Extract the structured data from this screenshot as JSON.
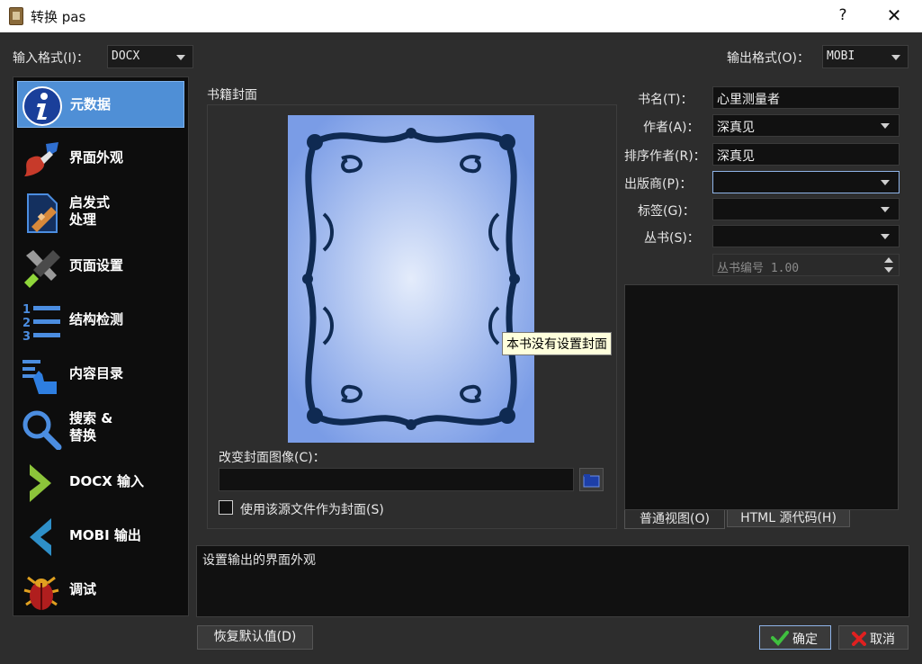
{
  "window": {
    "title": "转换 pas",
    "help": "?",
    "close": "✕"
  },
  "input_format": {
    "label": "输入格式(I)：",
    "value": "DOCX"
  },
  "output_format": {
    "label": "输出格式(O)：",
    "value": "MOBI"
  },
  "sidebar": {
    "items": [
      {
        "label": "元数据",
        "icon": "info-icon",
        "selected": true
      },
      {
        "label": "界面外观",
        "icon": "paintbrush-icon"
      },
      {
        "label1": "启发式",
        "label2": "处理",
        "icon": "document-bandage-icon"
      },
      {
        "label": "页面设置",
        "icon": "tools-icon"
      },
      {
        "label": "结构检测",
        "icon": "numbered-list-icon"
      },
      {
        "label": "内容目录",
        "icon": "toc-hand-icon"
      },
      {
        "label1": "搜索 &",
        "label2": "替换",
        "icon": "magnifier-icon"
      },
      {
        "label": "DOCX 输入",
        "icon": "chevron-right-icon"
      },
      {
        "label": "MOBI 输出",
        "icon": "chevron-left-icon"
      },
      {
        "label": "调试",
        "icon": "bug-icon"
      }
    ]
  },
  "cover": {
    "group_label": "书籍封面",
    "tooltip": "本书没有设置封面",
    "change_label": "改变封面图像(C)：",
    "path_value": "",
    "use_source_label": "使用该源文件作为封面(S)",
    "use_source_checked": false
  },
  "meta": {
    "title_label": "书名(T)：",
    "title_value": "心里测量者",
    "author_label": "作者(A)：",
    "author_value": "深真见",
    "author_sort_label": "排序作者(R)：",
    "author_sort_value": "深真见",
    "publisher_label": "出版商(P)：",
    "publisher_value": "",
    "tags_label": "标签(G)：",
    "tags_value": "",
    "series_label": "丛书(S)：",
    "series_value": "",
    "series_index": "丛书编号 1.00"
  },
  "tabs": [
    {
      "label": "普通视图(O)"
    },
    {
      "label": "HTML 源代码(H)"
    }
  ],
  "help_text": "设置输出的界面外观",
  "buttons": {
    "restore": "恢复默认值(D)",
    "ok": "确定",
    "cancel": "取消"
  },
  "colors": {
    "accent": "#4f8fd6",
    "background": "#2d2d2d",
    "field": "#111111"
  }
}
